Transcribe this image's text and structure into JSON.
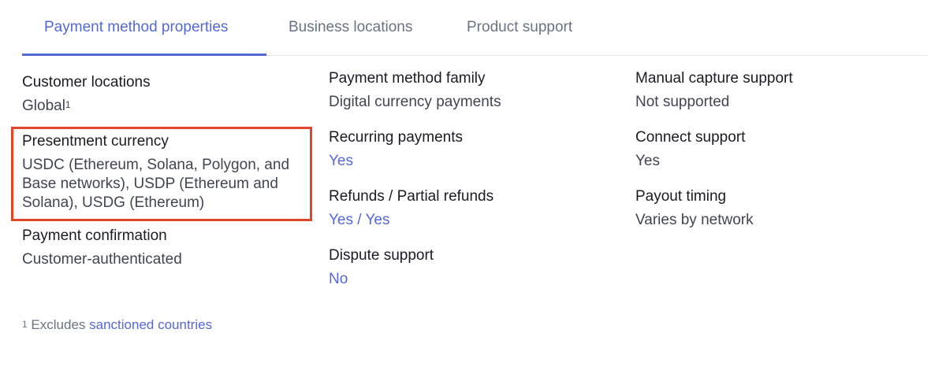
{
  "tabs": [
    {
      "label": "Payment method properties",
      "active": true
    },
    {
      "label": "Business locations",
      "active": false
    },
    {
      "label": "Product support",
      "active": false
    }
  ],
  "columns": {
    "left": [
      {
        "label": "Customer locations",
        "value": "Global",
        "footnote_mark": "1"
      },
      {
        "label": "Presentment currency",
        "value": "USDC (Ethereum, Solana, Polygon, and Base networks), USDP (Ethereum and Solana), USDG (Ethereum)"
      },
      {
        "label": "Payment confirmation",
        "value": "Customer-authenticated"
      }
    ],
    "middle": [
      {
        "label": "Payment method family",
        "value": "Digital currency payments"
      },
      {
        "label": "Recurring payments",
        "value": "Yes"
      },
      {
        "label": "Refunds / Partial refunds",
        "value": "Yes / Yes"
      },
      {
        "label": "Dispute support",
        "value": "No"
      }
    ],
    "right": [
      {
        "label": "Manual capture support",
        "value": "Not supported"
      },
      {
        "label": "Connect support",
        "value": "Yes"
      },
      {
        "label": "Payout timing",
        "value": "Varies by network"
      }
    ]
  },
  "footnote": {
    "mark": "1",
    "text": "Excludes",
    "link_text": "sanctioned countries"
  },
  "colors": {
    "accent": "#5469d4",
    "highlight_border": "#e0452e",
    "label": "#1a1b25",
    "value": "#414552",
    "muted": "#6a7383"
  }
}
